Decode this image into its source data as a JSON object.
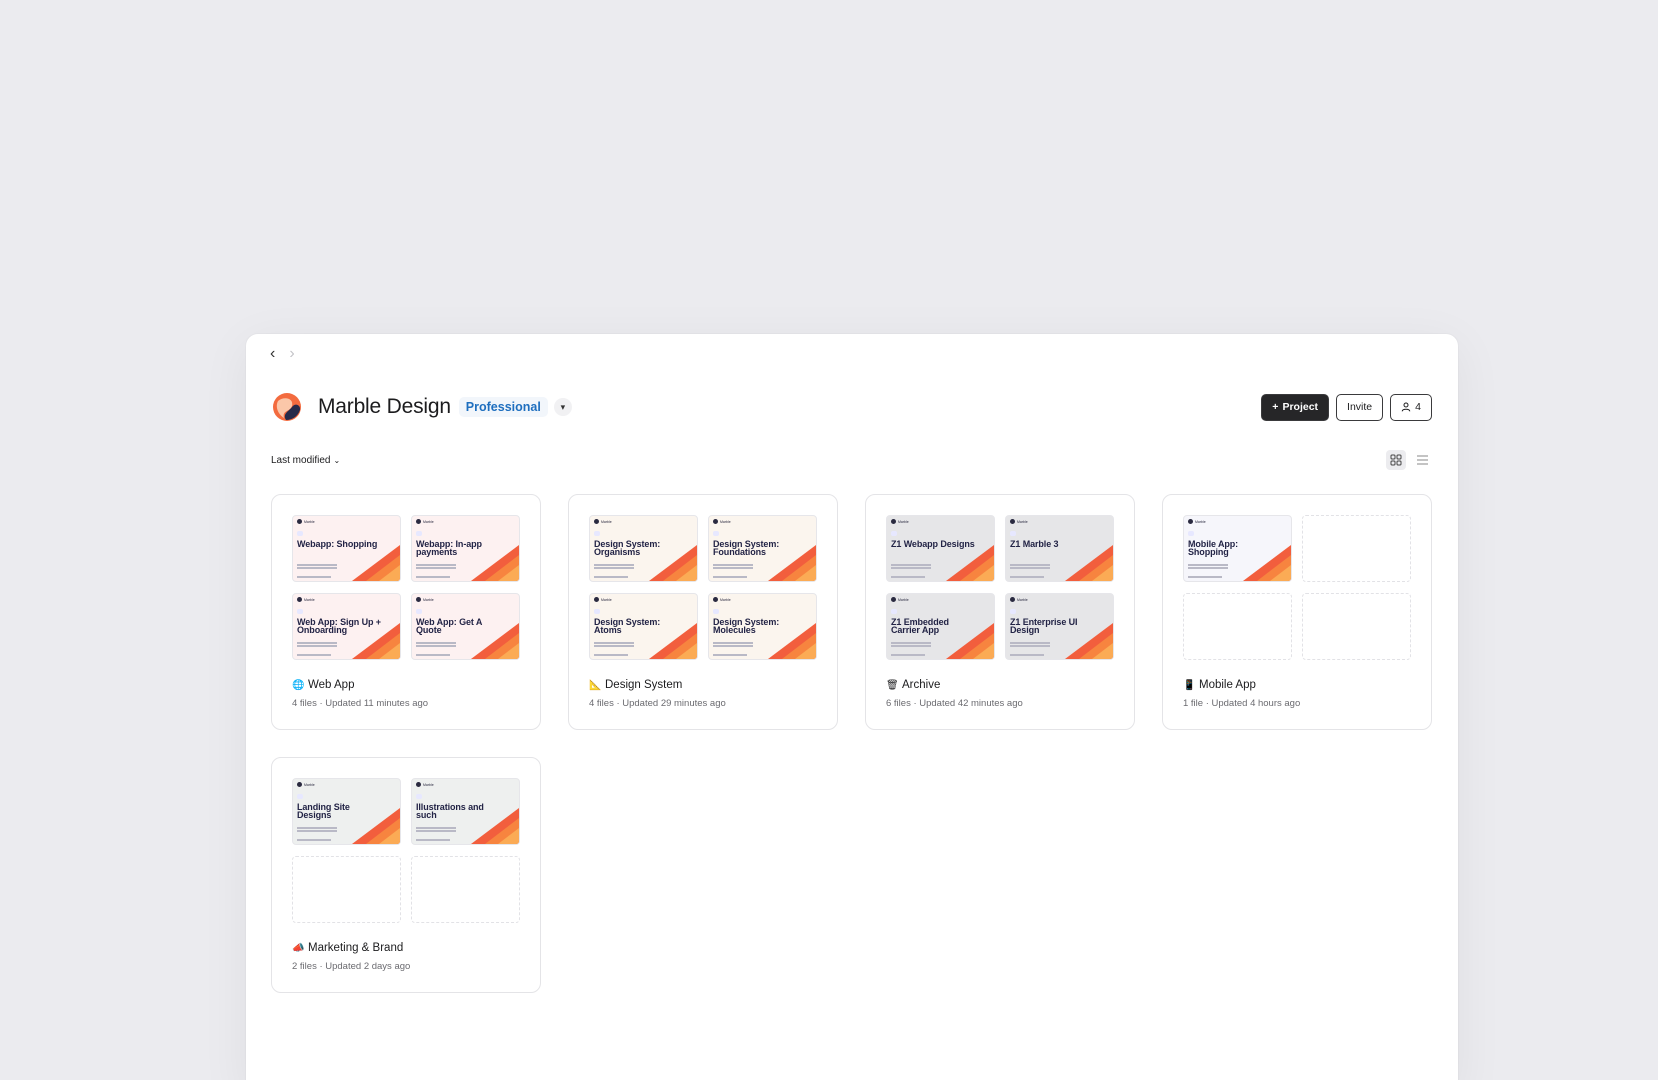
{
  "workspace": {
    "name": "Marble Design",
    "plan_badge": "Professional"
  },
  "actions": {
    "new_project": "Project",
    "invite": "Invite",
    "members_count": "4"
  },
  "toolbar": {
    "sort_label": "Last modified"
  },
  "projects": [
    {
      "name": "Web App",
      "icon": "globe-icon",
      "meta": "4 files · Updated 11 minutes ago",
      "bg": "#fdf1f1",
      "files": [
        "Webapp: Shopping",
        "Webapp: In-app payments",
        "Web App: Sign Up + Onboarding",
        "Web App: Get A Quote"
      ]
    },
    {
      "name": "Design System",
      "icon": "ruler-icon",
      "meta": "4 files · Updated 29 minutes ago",
      "bg": "#fbf5ee",
      "files": [
        "Design System: Organisms",
        "Design System: Foundations",
        "Design System: Atoms",
        "Design System: Molecules"
      ]
    },
    {
      "name": "Archive",
      "icon": "trash-icon",
      "meta": "6 files · Updated 42 minutes ago",
      "bg": "#e6e6e8",
      "files": [
        "Z1 Webapp Designs",
        "Z1 Marble 3",
        "Z1 Embedded Carrier App",
        "Z1 Enterprise UI Design"
      ]
    },
    {
      "name": "Mobile App",
      "icon": "phone-icon",
      "meta": "1 file · Updated 4 hours ago",
      "bg": "#f6f6fb",
      "files": [
        "Mobile App: Shopping"
      ]
    },
    {
      "name": "Marketing & Brand",
      "icon": "megaphone-icon",
      "meta": "2 files · Updated 2 days ago",
      "bg": "#eef0ef",
      "files": [
        "Landing Site Designs",
        "Illustrations and such"
      ]
    }
  ]
}
